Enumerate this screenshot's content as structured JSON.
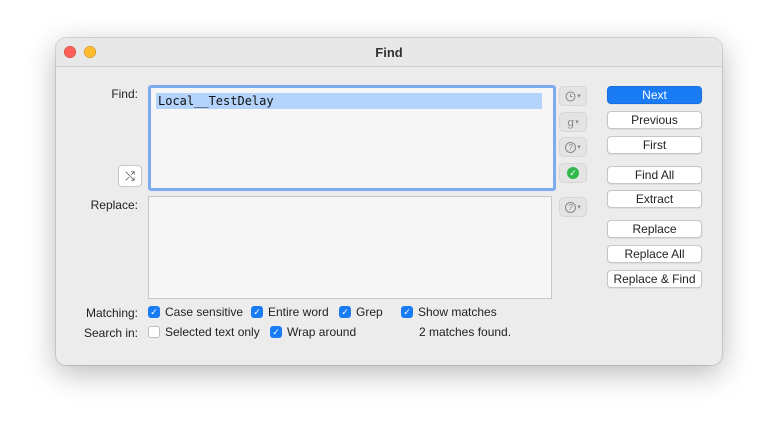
{
  "window": {
    "title": "Find"
  },
  "find": {
    "label": "Find:",
    "value": "Local__TestDelay"
  },
  "replace": {
    "label": "Replace:",
    "value": ""
  },
  "side_icons": {
    "history": "clock-icon",
    "grep": "g",
    "help": "?",
    "status_ok": "✓",
    "regex_toggle": "⤭"
  },
  "buttons": {
    "next": "Next",
    "previous": "Previous",
    "first": "First",
    "find_all": "Find All",
    "extract": "Extract",
    "replace": "Replace",
    "replace_all": "Replace All",
    "replace_and_find": "Replace & Find"
  },
  "matching": {
    "label": "Matching:",
    "case_sensitive": {
      "label": "Case sensitive",
      "checked": true
    },
    "entire_word": {
      "label": "Entire word",
      "checked": true
    },
    "grep": {
      "label": "Grep",
      "checked": true
    },
    "show_matches": {
      "label": "Show matches",
      "checked": true
    }
  },
  "search_in": {
    "label": "Search in:",
    "selected_text_only": {
      "label": "Selected text only",
      "checked": false
    },
    "wrap_around": {
      "label": "Wrap around",
      "checked": true
    }
  },
  "status": "2 matches found.",
  "colors": {
    "accent": "#1a7cf5",
    "selection": "#b3d3fb",
    "ok": "#30b94a"
  }
}
